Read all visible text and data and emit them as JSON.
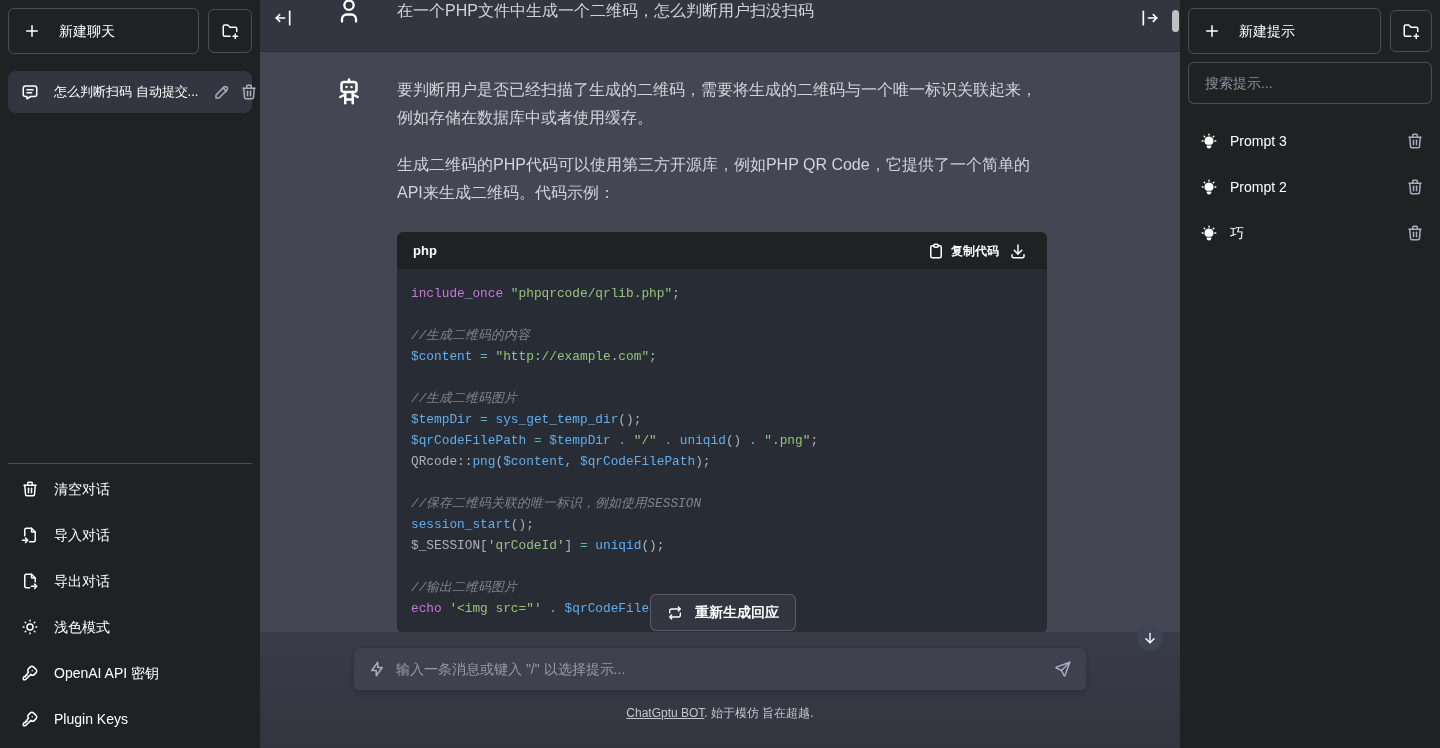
{
  "left_sidebar": {
    "new_chat_button": "新建聊天",
    "conversations": [
      {
        "title": "怎么判断扫码 自动提交...",
        "selected": true
      }
    ],
    "menu": [
      "清空对话",
      "导入对话",
      "导出对话",
      "浅色模式",
      "OpenAI API 密钥",
      "Plugin Keys"
    ]
  },
  "chat": {
    "messages": [
      {
        "kind": "user",
        "paragraphs": [
          "在一个PHP文件中生成一个二维码，怎么判断用户扫没扫码"
        ]
      },
      {
        "kind": "assistant",
        "paragraphs": [
          "要判断用户是否已经扫描了生成的二维码，需要将生成的二维码与一个唯一标识关联起来，例如存储在数据库中或者使用缓存。",
          "生成二维码的PHP代码可以使用第三方开源库，例如PHP QR Code，它提供了一个简单的API来生成二维码。代码示例："
        ],
        "code": {
          "language": "php",
          "copy_button": "复制代码",
          "blocks": [
            [
              [
                {
                  "kind": "keyword",
                  "text": "include_once "
                },
                {
                  "kind": "string",
                  "text": "\"phpqrcode/qrlib.php\""
                },
                {
                  "kind": "plain",
                  "text": ";"
                }
              ]
            ],
            [
              [
                {
                  "kind": "comment",
                  "text": "//生成二维码的内容"
                }
              ],
              [
                {
                  "kind": "name",
                  "text": "$content"
                },
                {
                  "kind": "operator",
                  "text": " = "
                },
                {
                  "kind": "string",
                  "text": "\"http://example.com\""
                },
                {
                  "kind": "plain",
                  "text": ";"
                }
              ]
            ],
            [
              [
                {
                  "kind": "comment",
                  "text": "//生成二维码图片"
                }
              ],
              [
                {
                  "kind": "name",
                  "text": "$tempDir"
                },
                {
                  "kind": "operator",
                  "text": " = "
                },
                {
                  "kind": "name",
                  "text": "sys_get_temp_dir"
                },
                {
                  "kind": "plain",
                  "text": "();"
                }
              ],
              [
                {
                  "kind": "name",
                  "text": "$qrCodeFilePath"
                },
                {
                  "kind": "operator",
                  "text": " = "
                },
                {
                  "kind": "name",
                  "text": "$tempDir"
                },
                {
                  "kind": "operator",
                  "text": " . "
                },
                {
                  "kind": "string",
                  "text": "\"/\""
                },
                {
                  "kind": "operator",
                  "text": " . "
                },
                {
                  "kind": "name",
                  "text": "uniqid"
                },
                {
                  "kind": "plain",
                  "text": "()"
                },
                {
                  "kind": "operator",
                  "text": " . "
                },
                {
                  "kind": "string",
                  "text": "\".png\""
                },
                {
                  "kind": "plain",
                  "text": ";"
                }
              ],
              [
                {
                  "kind": "plain",
                  "text": "QRcode::"
                },
                {
                  "kind": "name",
                  "text": "png"
                },
                {
                  "kind": "plain",
                  "text": "("
                },
                {
                  "kind": "name",
                  "text": "$content"
                },
                {
                  "kind": "plain",
                  "text": ", "
                },
                {
                  "kind": "name",
                  "text": "$qrCodeFilePath"
                },
                {
                  "kind": "plain",
                  "text": ");"
                }
              ]
            ],
            [
              [
                {
                  "kind": "comment",
                  "text": "//保存二维码关联的唯一标识，例如使用SESSION"
                }
              ],
              [
                {
                  "kind": "name",
                  "text": "session_start"
                },
                {
                  "kind": "plain",
                  "text": "();"
                }
              ],
              [
                {
                  "kind": "plain",
                  "text": "$_SESSION["
                },
                {
                  "kind": "string",
                  "text": "'qrCodeId'"
                },
                {
                  "kind": "plain",
                  "text": "]"
                },
                {
                  "kind": "operator",
                  "text": " = "
                },
                {
                  "kind": "name",
                  "text": "uniqid"
                },
                {
                  "kind": "plain",
                  "text": "();"
                }
              ]
            ],
            [
              [
                {
                  "kind": "comment",
                  "text": "//输出二维码图片"
                }
              ],
              [
                {
                  "kind": "keyword",
                  "text": "echo "
                },
                {
                  "kind": "string",
                  "text": "'<img src=\"'"
                },
                {
                  "kind": "operator",
                  "text": " . "
                },
                {
                  "kind": "name",
                  "text": "$qrCodeFile"
                }
              ]
            ]
          ]
        }
      }
    ],
    "regenerate_button": "重新生成回应",
    "input": {
      "placeholder": "输入一条消息或键入 \"/\" 以选择提示..."
    },
    "footer": {
      "link": "ChatGptu BOT",
      "text": ". 始于模仿 旨在超越."
    }
  },
  "right_sidebar": {
    "new_prompt_button": "新建提示",
    "search": {
      "placeholder": "搜索提示..."
    },
    "prompts": [
      "Prompt 3",
      "Prompt 2",
      "巧"
    ]
  }
}
